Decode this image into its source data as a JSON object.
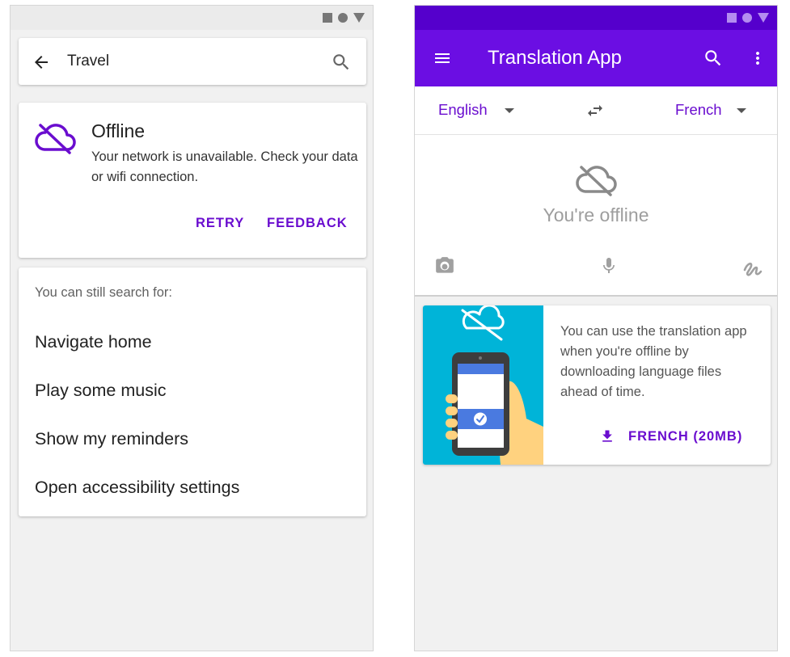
{
  "colors": {
    "accent": "#6a0dcf",
    "app_bar": "#6b0ee3",
    "status_bar_dark": "#5500cc",
    "illustration_bg": "#00b4d8"
  },
  "left_screen": {
    "search_bar": {
      "query": "Travel",
      "back_icon": "arrow-left-icon",
      "search_icon": "search-icon"
    },
    "offline_card": {
      "icon": "cloud-off-icon",
      "title": "Offline",
      "message": "Your network is unavailable. Check your data or wifi connection.",
      "retry_label": "RETRY",
      "feedback_label": "FEEDBACK"
    },
    "suggestions": {
      "hint": "You can still search for:",
      "items": [
        "Navigate home",
        "Play some music",
        "Show my reminders",
        "Open accessibility settings"
      ]
    }
  },
  "right_screen": {
    "app_bar": {
      "title": "Translation App",
      "menu_icon": "menu-icon",
      "search_icon": "search-icon",
      "more_icon": "more-vert-icon"
    },
    "languages": {
      "source": "English",
      "target": "French",
      "swap_icon": "swap-icon"
    },
    "input_area": {
      "offline_label": "You're offline",
      "icons": [
        "cloud-off-icon",
        "camera-icon",
        "mic-icon",
        "handwriting-icon"
      ]
    },
    "download_card": {
      "message": "You can use the translation app when you're offline by downloading language files ahead of time.",
      "download_label": "FRENCH (20MB)",
      "download_icon": "download-icon"
    }
  }
}
